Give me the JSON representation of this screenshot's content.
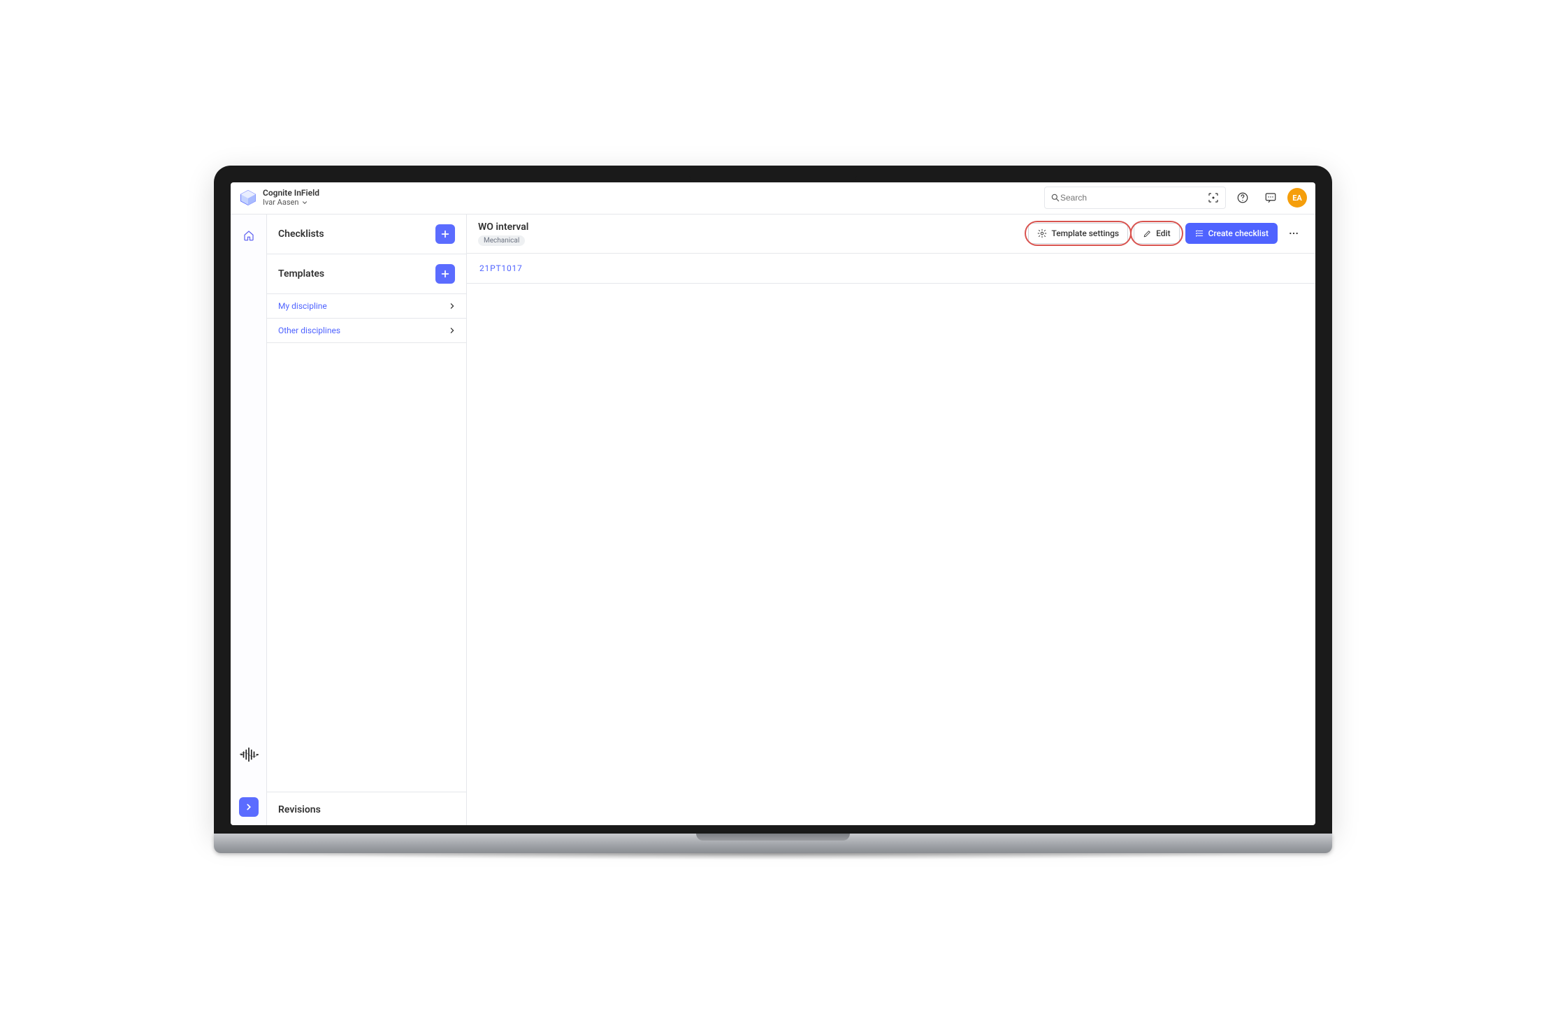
{
  "header": {
    "app_name": "Cognite InField",
    "workspace": "Ivar Aasen",
    "search_placeholder": "Search",
    "avatar_initials": "EA",
    "avatar_bg": "#f59e0b"
  },
  "sidebar": {
    "sections": {
      "checklists_title": "Checklists",
      "templates_title": "Templates",
      "revisions_title": "Revisions"
    },
    "links": [
      {
        "label": "My discipline"
      },
      {
        "label": "Other disciplines"
      }
    ]
  },
  "main": {
    "title": "WO interval",
    "tag": "Mechanical",
    "buttons": {
      "template_settings": "Template settings",
      "edit": "Edit",
      "create_checklist": "Create checklist"
    },
    "items": [
      {
        "code": "21PT1017"
      }
    ]
  },
  "colors": {
    "primary": "#4F63FF",
    "accent_btn": "#5B6CFF"
  }
}
